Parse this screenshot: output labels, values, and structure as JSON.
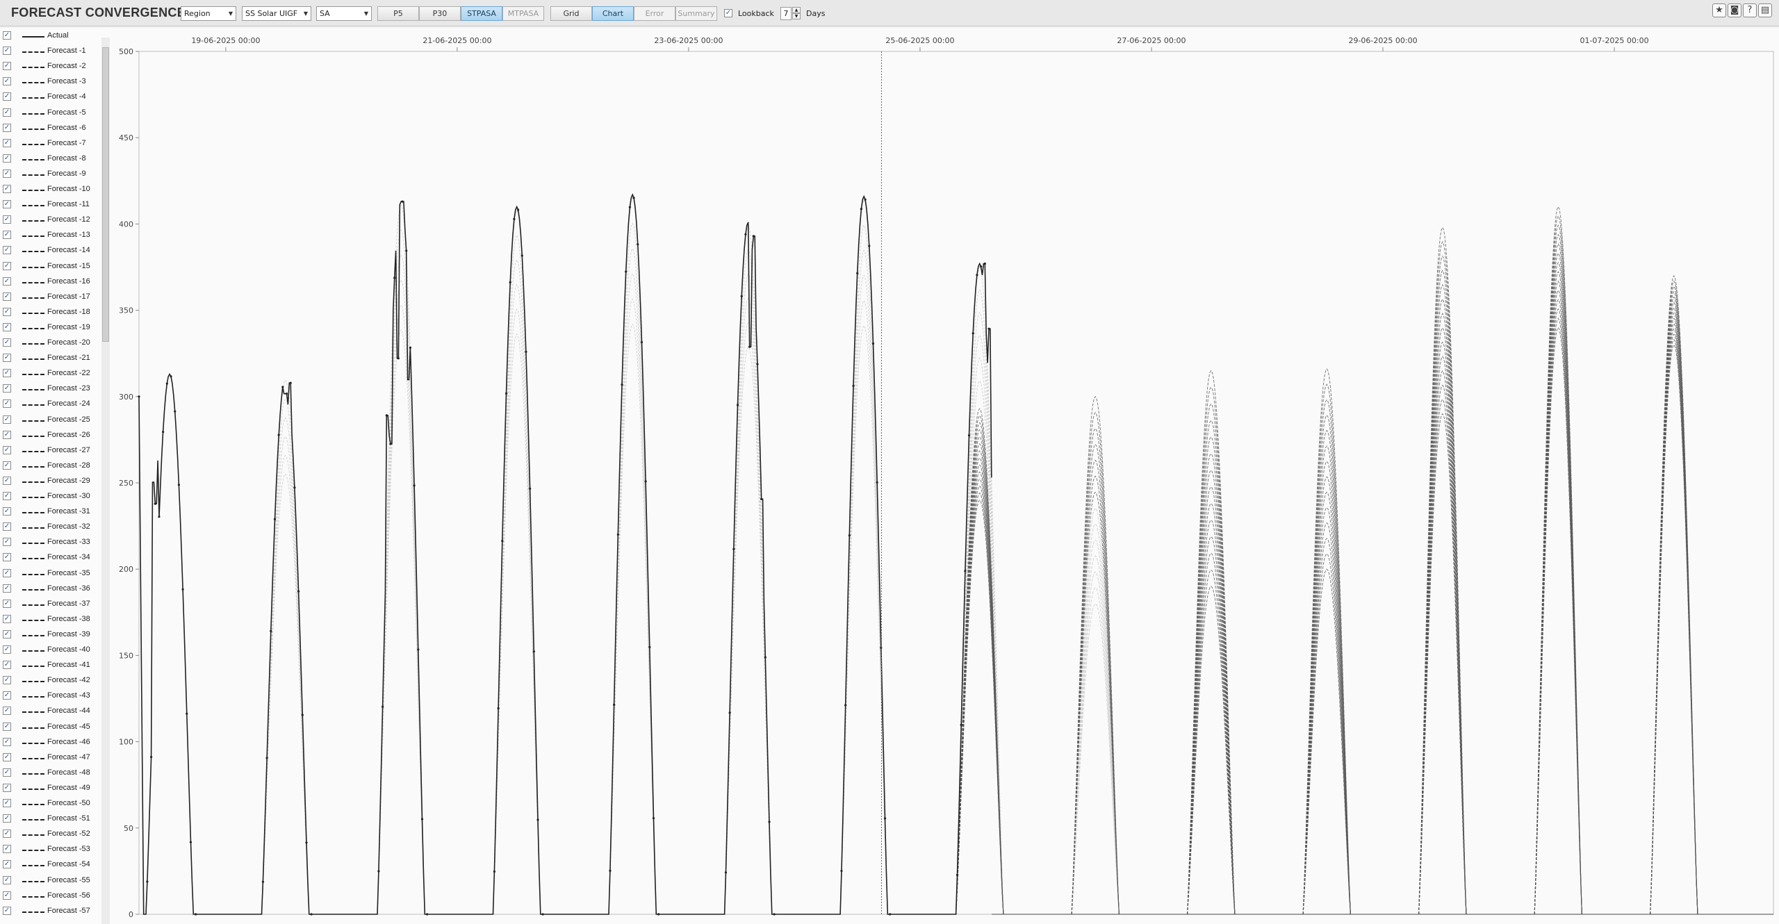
{
  "app": {
    "title": "FORECAST CONVERGENCE"
  },
  "toolbar": {
    "combos": [
      {
        "key": "type",
        "value": "Region"
      },
      {
        "key": "metric",
        "value": "SS Solar UIGF"
      },
      {
        "key": "region",
        "value": "SA"
      }
    ],
    "run_buttons": [
      {
        "label": "P5",
        "active": false
      },
      {
        "label": "P30",
        "active": false
      },
      {
        "label": "STPASA",
        "active": true
      },
      {
        "label": "MTPASA",
        "active": false
      }
    ],
    "view_buttons": [
      {
        "label": "Grid",
        "active": false
      },
      {
        "label": "Chart",
        "active": true
      },
      {
        "label": "Error",
        "active": false
      },
      {
        "label": "Summary",
        "active": false
      }
    ],
    "lookback": {
      "label": "Lookback",
      "checked": true,
      "value": "7",
      "unit": "Days"
    }
  },
  "legend": {
    "items": [
      {
        "label": "Actual",
        "style": "solid"
      },
      {
        "label": "Forecast -1",
        "style": "dashed"
      },
      {
        "label": "Forecast -2",
        "style": "dashed"
      },
      {
        "label": "Forecast -3",
        "style": "dashed"
      },
      {
        "label": "Forecast -4",
        "style": "dashed"
      },
      {
        "label": "Forecast -5",
        "style": "dashed"
      },
      {
        "label": "Forecast -6",
        "style": "dashed"
      },
      {
        "label": "Forecast -7",
        "style": "dashed"
      },
      {
        "label": "Forecast -8",
        "style": "dashed"
      },
      {
        "label": "Forecast -9",
        "style": "dashed"
      },
      {
        "label": "Forecast -10",
        "style": "dashed"
      },
      {
        "label": "Forecast -11",
        "style": "dashed"
      },
      {
        "label": "Forecast -12",
        "style": "dashed"
      },
      {
        "label": "Forecast -13",
        "style": "dashed"
      },
      {
        "label": "Forecast -14",
        "style": "dashed"
      },
      {
        "label": "Forecast -15",
        "style": "dashed"
      },
      {
        "label": "Forecast -16",
        "style": "dashed"
      },
      {
        "label": "Forecast -17",
        "style": "dashed"
      },
      {
        "label": "Forecast -18",
        "style": "dashed"
      },
      {
        "label": "Forecast -19",
        "style": "dashed"
      },
      {
        "label": "Forecast -20",
        "style": "dashed"
      },
      {
        "label": "Forecast -21",
        "style": "dashed"
      },
      {
        "label": "Forecast -22",
        "style": "dashed"
      },
      {
        "label": "Forecast -23",
        "style": "dashed"
      },
      {
        "label": "Forecast -24",
        "style": "dashed"
      },
      {
        "label": "Forecast -25",
        "style": "dashed"
      },
      {
        "label": "Forecast -26",
        "style": "dashed"
      },
      {
        "label": "Forecast -27",
        "style": "dashed"
      },
      {
        "label": "Forecast -28",
        "style": "dashed"
      },
      {
        "label": "Forecast -29",
        "style": "dashed"
      },
      {
        "label": "Forecast -30",
        "style": "dashed"
      },
      {
        "label": "Forecast -31",
        "style": "dashed"
      },
      {
        "label": "Forecast -32",
        "style": "dashed"
      },
      {
        "label": "Forecast -33",
        "style": "dashed"
      },
      {
        "label": "Forecast -34",
        "style": "dashed"
      },
      {
        "label": "Forecast -35",
        "style": "dashed"
      },
      {
        "label": "Forecast -36",
        "style": "dashed"
      },
      {
        "label": "Forecast -37",
        "style": "dashed"
      },
      {
        "label": "Forecast -38",
        "style": "dashed"
      },
      {
        "label": "Forecast -39",
        "style": "dashed"
      },
      {
        "label": "Forecast -40",
        "style": "dashed"
      },
      {
        "label": "Forecast -41",
        "style": "dashed"
      },
      {
        "label": "Forecast -42",
        "style": "dashed"
      },
      {
        "label": "Forecast -43",
        "style": "dashed"
      },
      {
        "label": "Forecast -44",
        "style": "dashed"
      },
      {
        "label": "Forecast -45",
        "style": "dashed"
      },
      {
        "label": "Forecast -46",
        "style": "dashed"
      },
      {
        "label": "Forecast -47",
        "style": "dashed"
      },
      {
        "label": "Forecast -48",
        "style": "dashed"
      },
      {
        "label": "Forecast -49",
        "style": "dashed"
      },
      {
        "label": "Forecast -50",
        "style": "dashed"
      },
      {
        "label": "Forecast -51",
        "style": "dashed"
      },
      {
        "label": "Forecast -52",
        "style": "dashed"
      },
      {
        "label": "Forecast -53",
        "style": "dashed"
      },
      {
        "label": "Forecast -54",
        "style": "dashed"
      },
      {
        "label": "Forecast -55",
        "style": "dashed"
      },
      {
        "label": "Forecast -56",
        "style": "dashed"
      },
      {
        "label": "Forecast -57",
        "style": "dashed"
      }
    ]
  },
  "icons": [
    "star-icon",
    "camera-icon",
    "help-icon",
    "comment-icon"
  ],
  "colors": {
    "actual": "#222222",
    "forecast_dark": "#444444",
    "forecast_light": "#c8c8c8",
    "active_button": "#a9d3f0"
  },
  "chart_data": {
    "type": "line",
    "ylim": [
      0,
      500
    ],
    "yticks": [
      0,
      50,
      100,
      150,
      200,
      250,
      300,
      350,
      400,
      450,
      500
    ],
    "xlim": [
      "2025-06-18 06:00",
      "2025-07-02 09:00"
    ],
    "xticks": [
      {
        "label": "19-06-2025 00:00",
        "day": 1
      },
      {
        "label": "21-06-2025 00:00",
        "day": 3
      },
      {
        "label": "23-06-2025 00:00",
        "day": 5
      },
      {
        "label": "25-06-2025 00:00",
        "day": 7
      },
      {
        "label": "27-06-2025 00:00",
        "day": 9
      },
      {
        "label": "29-06-2025 00:00",
        "day": 11
      },
      {
        "label": "01-07-2025 00:00",
        "day": 13
      }
    ],
    "now_marker": "2025-06-24 16:00",
    "series_actual": {
      "name": "Actual",
      "days": [
        {
          "date": "18-06-2025",
          "peak": 313
        },
        {
          "date": "19-06-2025",
          "peak": 311
        },
        {
          "date": "20-06-2025",
          "peak": 413
        },
        {
          "date": "21-06-2025",
          "peak": 410
        },
        {
          "date": "22-06-2025",
          "peak": 417
        },
        {
          "date": "23-06-2025",
          "peak": 401
        },
        {
          "date": "24-06-2025",
          "peak": 416
        },
        {
          "date": "25-06-2025",
          "peak": 377
        }
      ]
    },
    "forecast_envelopes": [
      {
        "date": "25-06-2025",
        "min": 240,
        "max": 293
      },
      {
        "date": "26-06-2025",
        "min": 180,
        "max": 300
      },
      {
        "date": "27-06-2025",
        "min": 190,
        "max": 315
      },
      {
        "date": "28-06-2025",
        "min": 200,
        "max": 316
      },
      {
        "date": "29-06-2025",
        "min": 290,
        "max": 398
      },
      {
        "date": "30-06-2025",
        "min": 340,
        "max": 410
      },
      {
        "date": "01-07-2025",
        "min": 330,
        "max": 370
      }
    ]
  }
}
